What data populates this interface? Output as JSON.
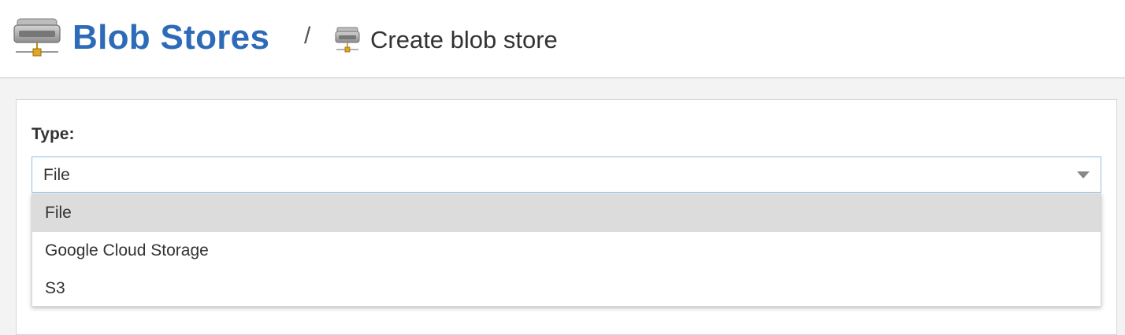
{
  "breadcrumb": {
    "title": "Blob Stores",
    "separator": "/",
    "current": "Create blob store",
    "title_icon": "blob-store-icon",
    "current_icon": "blob-store-small-icon"
  },
  "form": {
    "type_label": "Type:",
    "type_select": {
      "value": "File",
      "options": [
        "File",
        "Google Cloud Storage",
        "S3"
      ],
      "highlighted_index": 0
    }
  },
  "colors": {
    "accent": "#2d6ab8",
    "select_border": "#8fbfe4",
    "highlight": "#dcdcdc"
  }
}
